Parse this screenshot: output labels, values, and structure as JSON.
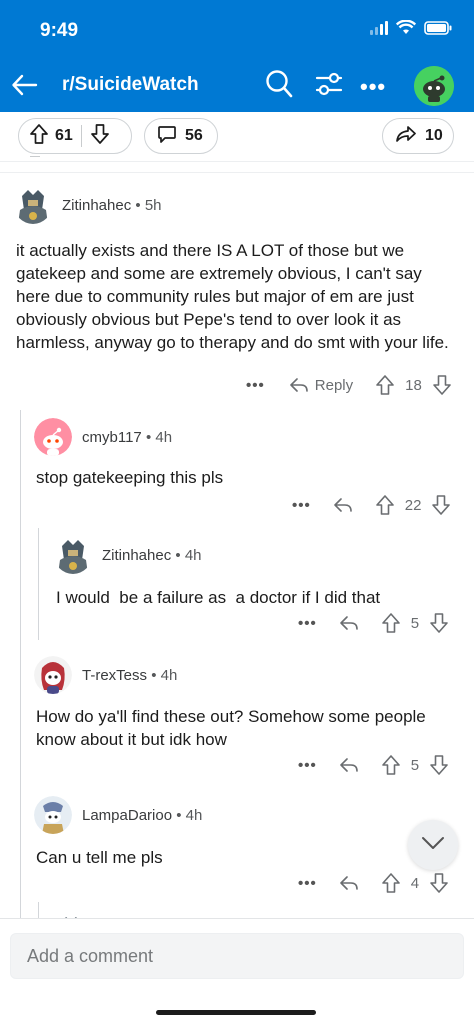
{
  "status_bar": {
    "time": "9:49"
  },
  "header": {
    "subreddit": "r/SuicideWatch"
  },
  "post_actions": {
    "upvotes": "61",
    "comments": "56",
    "shares": "10"
  },
  "comments": [
    {
      "author": "Zitinhahec",
      "age": "5h",
      "body": "it actually exists and there IS A LOT of those but we gatekeep and some are extremely obvious, I can't say here due to community rules but major of em are just obviously obvious but Pepe's tend to over look it as harmless, anyway go to therapy and do smt with your life.",
      "reply_label": "Reply",
      "score": "18"
    },
    {
      "author": "cmyb117",
      "age": "4h",
      "body": "stop gatekeeping this pls",
      "score": "22"
    },
    {
      "author": "Zitinhahec",
      "age": "4h",
      "body": "I would  be a failure as  a doctor if I did that",
      "score": "5"
    },
    {
      "author": "T-rexTess",
      "age": "4h",
      "body": "How do ya'll find these out? Somehow some people know about it but idk how",
      "score": "5"
    },
    {
      "author": "LampaDarioo",
      "age": "4h",
      "body": "Can u tell me pls",
      "score": "4"
    }
  ],
  "composer": {
    "placeholder": "Add a comment"
  },
  "icons": {
    "back": "arrow-left-icon",
    "search": "search-icon",
    "filter": "filter-icon",
    "more": "more-icon",
    "upvote": "upvote-icon",
    "downvote": "downvote-icon",
    "comment": "comment-icon",
    "share": "share-icon",
    "reply": "reply-icon",
    "jump": "chevron-down-icon"
  },
  "colors": {
    "brand": "#0079d3",
    "header_text": "#ffffff",
    "avatar_green": "#46d160"
  }
}
